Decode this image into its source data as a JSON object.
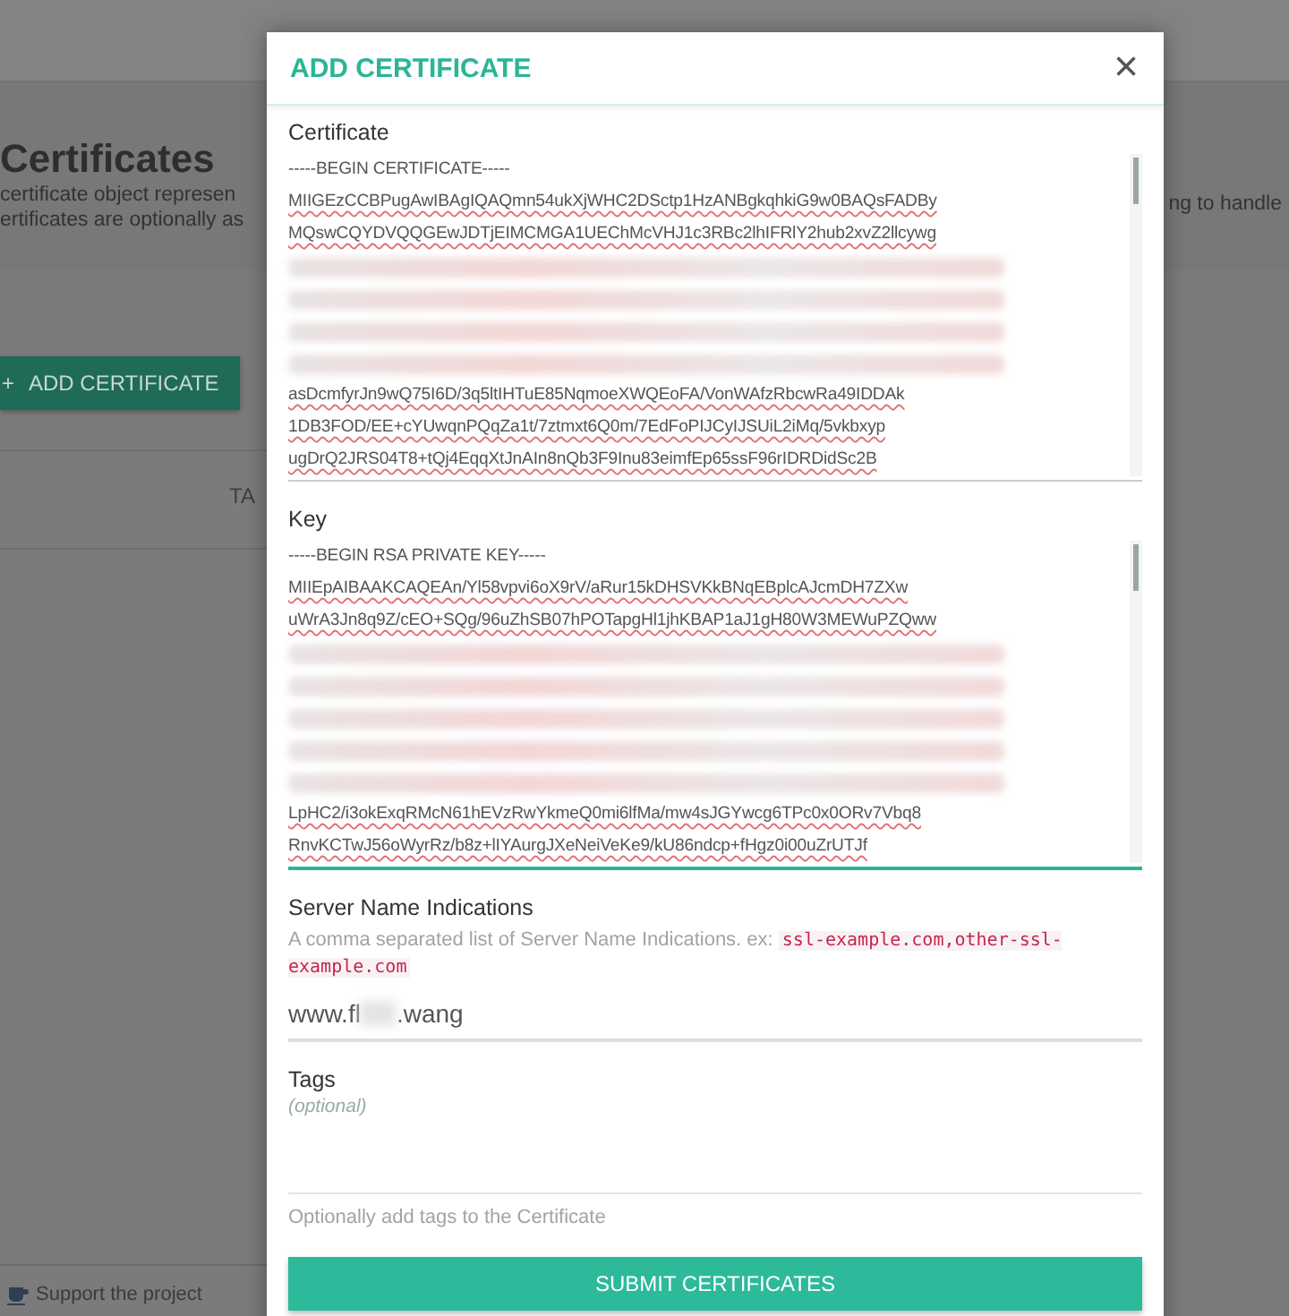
{
  "background": {
    "title": "Certificates",
    "description_lines": [
      "certificate object represen",
      "ertificates are optionally as"
    ],
    "description_right": "ng to handle",
    "add_button": {
      "icon": "+",
      "label": "ADD CERTIFICATE"
    },
    "column_header": "TA",
    "support_link": "Support the project"
  },
  "modal": {
    "title": "ADD CERTIFICATE",
    "close": "×",
    "certificate": {
      "label": "Certificate",
      "focused": false,
      "lines": [
        {
          "kind": "text",
          "text": "-----BEGIN CERTIFICATE-----"
        },
        {
          "kind": "text",
          "text": "MIIGEzCCBPugAwIBAgIQAQmn54ukXjWHC2DSctp1HzANBgkqhkiG9w0BAQsFADBy"
        },
        {
          "kind": "text",
          "text": "MQswCQYDVQQGEwJDTjEIMCMGA1UEChMcVHJ1c3RBc2lhIFRlY2hub2xvZ2llcywg"
        },
        {
          "kind": "blurred"
        },
        {
          "kind": "blurred"
        },
        {
          "kind": "blurred"
        },
        {
          "kind": "blurred"
        },
        {
          "kind": "text",
          "text": "asDcmfyrJn9wQ75I6D/3q5ltIHTuE85NqmoeXWQEoFA/VonWAfzRbcwRa49IDDAk"
        },
        {
          "kind": "text",
          "text": "1DB3FOD/EE+cYUwqnPQqZa1t/7ztmxt6Q0m/7EdFoPIJCyIJSUiL2iMq/5vkbxyp"
        },
        {
          "kind": "text",
          "text": "ugDrQ2JRS04T8+tQj4EqqXtJnAIn8nQb3F9Inu83eimfEp65ssF96rIDRDidSc2B"
        }
      ]
    },
    "key": {
      "label": "Key",
      "focused": true,
      "lines": [
        {
          "kind": "text",
          "text": "-----BEGIN RSA PRIVATE KEY-----"
        },
        {
          "kind": "text",
          "text": "MIIEpAIBAAKCAQEAn/Yl58vpvi6oX9rV/aRur15kDHSVKkBNqEBplcAJcmDH7ZXw"
        },
        {
          "kind": "text",
          "text": "uWrA3Jn8q9Z/cEO+SQg/96uZhSB07hPOTapgHl1jhKBAP1aJ1gH80W3MEWuPZQww"
        },
        {
          "kind": "blurred"
        },
        {
          "kind": "blurred"
        },
        {
          "kind": "blurred"
        },
        {
          "kind": "blurred"
        },
        {
          "kind": "blurred"
        },
        {
          "kind": "text",
          "text": "LpHC2/i3okExqRMcN61hEVzRwYkmeQ0mi6lfMa/mw4sJGYwcg6TPc0x0ORv7Vbq8"
        },
        {
          "kind": "text",
          "text": "RnvKCTwJ56oWyrRz/b8z+lIYAurgJXeNeiVeKe9/kU86ndcp+fHgz0i00uZrUTJf"
        }
      ]
    },
    "sni": {
      "label": "Server Name Indications",
      "help": "A comma separated list of Server Name Indications. ex: ",
      "help_code": "ssl-example.com,other-ssl-example.com",
      "value_start": "www.fl",
      "value_end": ".wang"
    },
    "tags": {
      "label": "Tags",
      "optional": "(optional)",
      "help": "Optionally add tags to the Certificate"
    },
    "submit": "SUBMIT CERTIFICATES"
  }
}
